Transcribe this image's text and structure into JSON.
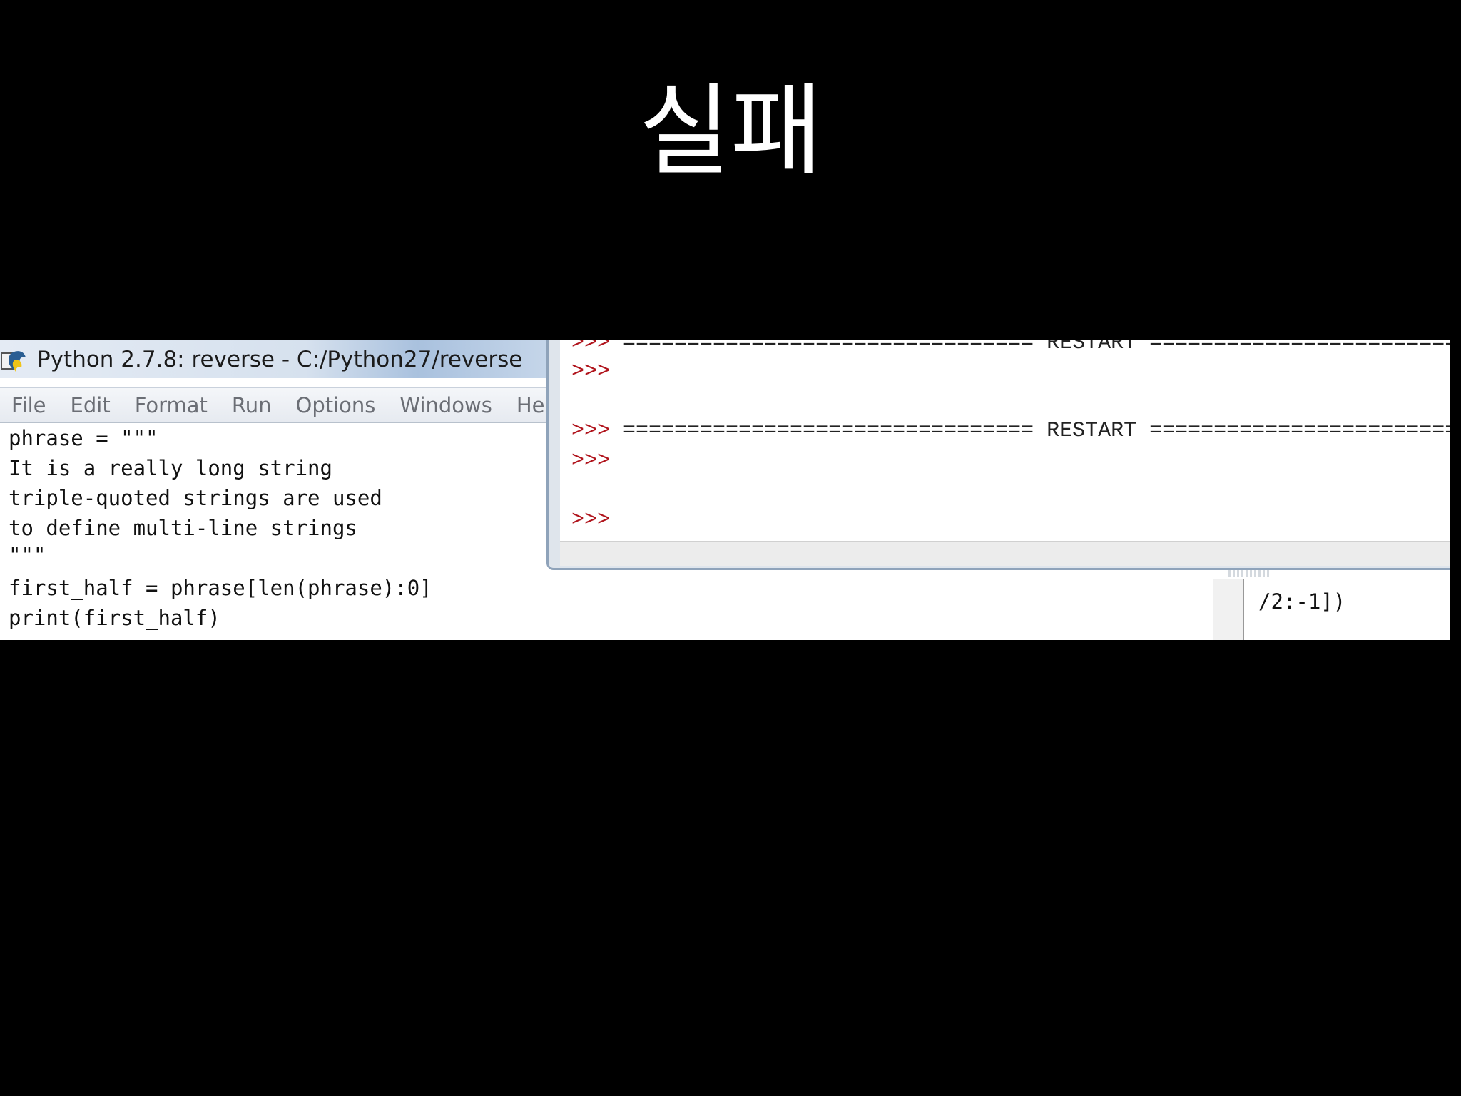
{
  "slide": {
    "title": "실패"
  },
  "editor": {
    "title": "Python 2.7.8: reverse - C:/Python27/reverse",
    "menu": [
      "File",
      "Edit",
      "Format",
      "Run",
      "Options",
      "Windows",
      "He"
    ],
    "code_lines": [
      "phrase = \"\"\"",
      "It is a really long string",
      "triple-quoted strings are used",
      "to define multi-line strings",
      "\"\"\"",
      "first_half = phrase[len(phrase):0]",
      "print(first_half)"
    ]
  },
  "shell": {
    "lines": [
      {
        "prompt": ">>>",
        "text": " ================================ RESTART ================================"
      },
      {
        "prompt": ">>>",
        "text": ""
      },
      {
        "prompt": ">>>",
        "text": " ================================ RESTART ================================"
      },
      {
        "prompt": ">>>",
        "text": ""
      },
      {
        "prompt": ">>>",
        "text": ""
      }
    ]
  },
  "other_window": {
    "code_fragment": "/2:-1])"
  },
  "colors": {
    "prompt": "#b0141c",
    "background": "#000000",
    "title_text": "#ffffff"
  },
  "icons": {
    "app": "python-idle-icon"
  }
}
